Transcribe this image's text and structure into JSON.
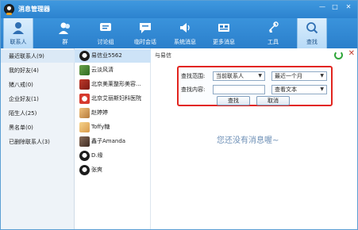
{
  "window": {
    "title": "消息管理器",
    "minimize_glyph": "—",
    "maximize_glyph": "□",
    "close_glyph": "✕"
  },
  "toolbar": {
    "items": [
      {
        "label": "联系人",
        "icon": "contacts-icon",
        "active": true
      },
      {
        "label": "群",
        "icon": "group-icon",
        "active": false
      },
      {
        "label": "讨论组",
        "icon": "discussion-group-icon",
        "active": false
      },
      {
        "label": "临时会话",
        "icon": "temp-session-icon",
        "active": false
      },
      {
        "label": "系统消息",
        "icon": "system-message-icon",
        "active": false
      },
      {
        "label": "更多消息",
        "icon": "more-messages-icon",
        "active": false
      },
      {
        "label": "工具",
        "icon": "tools-icon",
        "active": false
      },
      {
        "label": "查找",
        "icon": "search-icon",
        "active": true
      }
    ]
  },
  "groups": [
    {
      "label": "最近联系人(9)",
      "selected": true
    },
    {
      "label": "我的好友(4)",
      "selected": false
    },
    {
      "label": "猪八戒(0)",
      "selected": false
    },
    {
      "label": "企业好友(1)",
      "selected": false
    },
    {
      "label": "陌生人(25)",
      "selected": false
    },
    {
      "label": "黑名单(0)",
      "selected": false
    },
    {
      "label": "已删除联系人(3)",
      "selected": false
    }
  ],
  "contacts": [
    {
      "name": "易信业5562",
      "selected": true
    },
    {
      "name": "云淡风清",
      "selected": false
    },
    {
      "name": "北京美莱整形美容...",
      "selected": false
    },
    {
      "name": "北京艾丽斯妇科医院",
      "selected": false
    },
    {
      "name": "赵婷婷",
      "selected": false
    },
    {
      "name": "Toffy糖",
      "selected": false
    },
    {
      "name": "鑫子Amanda",
      "selected": false
    },
    {
      "name": "D.缘",
      "selected": false
    },
    {
      "name": "张爽",
      "selected": false
    }
  ],
  "message_area": {
    "with_label": "与易信",
    "empty_text": "您还没有消息喔~"
  },
  "search": {
    "range_label": "查找范围:",
    "range_value": "当前联系人",
    "period_value": "最近一个月",
    "content_label": "查找内容:",
    "content_value": "",
    "view_value": "查看文本",
    "find_button": "查找",
    "cancel_button": "取消"
  },
  "colors": {
    "titlebar": "#3f98df",
    "highlight_border": "#e2251f",
    "empty_text": "#6d8fb6"
  }
}
